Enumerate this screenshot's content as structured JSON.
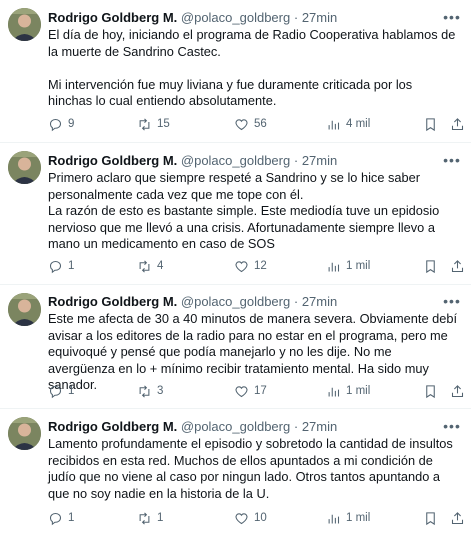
{
  "tweets": [
    {
      "name": "Rodrigo Goldberg M.",
      "handle": "@polaco_goldberg",
      "dot": "·",
      "time": "27min",
      "text": "El día de hoy, iniciando el programa de Radio Cooperativa hablamos de la muerte de Sandrino Castec.\n\nMi intervención fue muy liviana y fue duramente criticada por los hinchas lo cual entiendo absolutamente.",
      "replies": "9",
      "retweets": "15",
      "likes": "56",
      "views": "4 mil"
    },
    {
      "name": "Rodrigo Goldberg M.",
      "handle": "@polaco_goldberg",
      "dot": "·",
      "time": "27min",
      "text": "Primero aclaro que siempre respeté a Sandrino y se lo hice saber personalmente cada vez que me tope con él.\nLa razón de esto es bastante simple. Este mediodía tuve un epidosio nervioso que me llevó a una crisis. Afortunadamente siempre llevo a mano un medicamento en caso de SOS",
      "replies": "1",
      "retweets": "4",
      "likes": "12",
      "views": "1 mil"
    },
    {
      "name": "Rodrigo Goldberg M.",
      "handle": "@polaco_goldberg",
      "dot": "·",
      "time": "27min",
      "text": "Este me afecta de 30 a 40 minutos de manera severa. Obviamente debí avisar a los editores de la radio para no estar en el programa, pero me equivoqué y pensé que podía manejarlo y no les dije. No me avergüenza en lo + mínimo recibir tratamiento mental. Ha sido muy sanador.",
      "replies": "1",
      "retweets": "3",
      "likes": "17",
      "views": "1 mil"
    },
    {
      "name": "Rodrigo Goldberg M.",
      "handle": "@polaco_goldberg",
      "dot": "·",
      "time": "27min",
      "text": "Lamento profundamente el episodio y sobretodo la cantidad de insultos recibidos en esta red. Muchos de ellos apuntados a mi condición de judío que no viene al caso por ningun lado. Otros tantos apuntando a que no soy nadie en la historia de la U.",
      "replies": "1",
      "retweets": "1",
      "likes": "10",
      "views": "1 mil"
    }
  ],
  "icons": {
    "reply": "reply-icon",
    "retweet": "retweet-icon",
    "like": "heart-icon",
    "views": "views-chart-icon",
    "bookmark": "bookmark-icon",
    "share": "share-icon",
    "more": "more-icon"
  },
  "colors": {
    "text": "#0f1419",
    "secondary": "#536471",
    "divider": "#eff3f4",
    "background": "#ffffff"
  }
}
